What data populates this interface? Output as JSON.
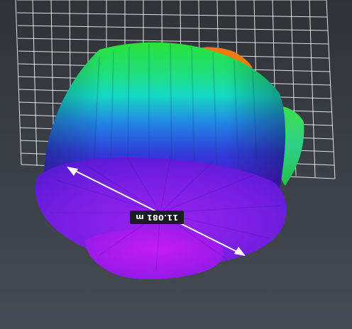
{
  "viewport": {
    "background_top": "#2f3338",
    "background_bottom": "#454b52",
    "grid_color": "#ffffff"
  },
  "model": {
    "type": "3D point cloud / mesh",
    "colormap": [
      "#ff8a00",
      "#22e34a",
      "#18d9c8",
      "#2a6fe0",
      "#3b1fd6",
      "#8a1ee8",
      "#c019f0"
    ],
    "top_cap_color": "#f07a10"
  },
  "measurement": {
    "label": "11.081 m",
    "line_color": "#ffffff"
  }
}
